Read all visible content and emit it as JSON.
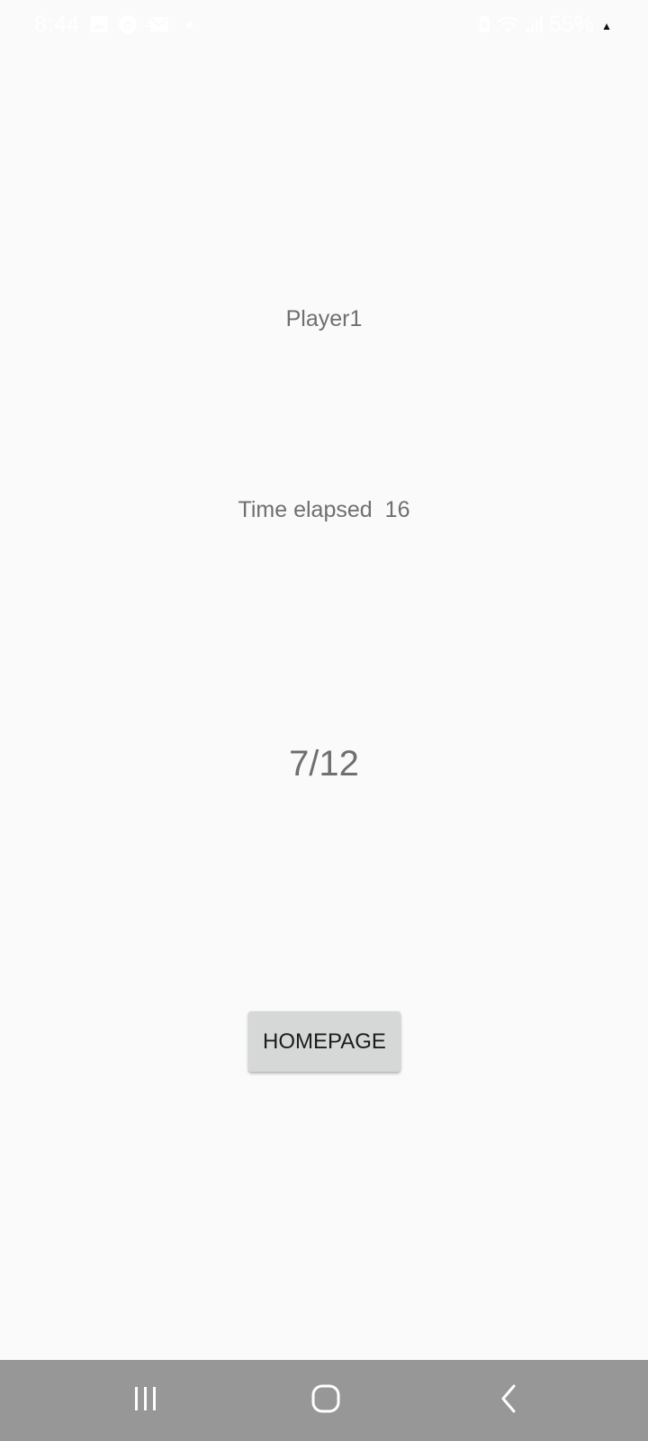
{
  "status_bar": {
    "time": "8:44",
    "battery": "55%",
    "icons": [
      "image-icon",
      "chrome-icon",
      "mail-icon",
      "notification-dot",
      "sim-icon",
      "wifi-icon",
      "signal-icon",
      "battery-icon"
    ]
  },
  "game": {
    "player_name": "Player1",
    "time_label": "Time elapsed",
    "time_value": "16",
    "score": "7/12"
  },
  "actions": {
    "homepage_label": "HOMEPAGE"
  },
  "nav_bar": {
    "icons": [
      "recents-icon",
      "home-icon",
      "back-icon"
    ]
  },
  "colors": {
    "background": "#fafafa",
    "text": "#6f6f6f",
    "button": "#d6d7d7",
    "nav_bar": "#979797"
  }
}
